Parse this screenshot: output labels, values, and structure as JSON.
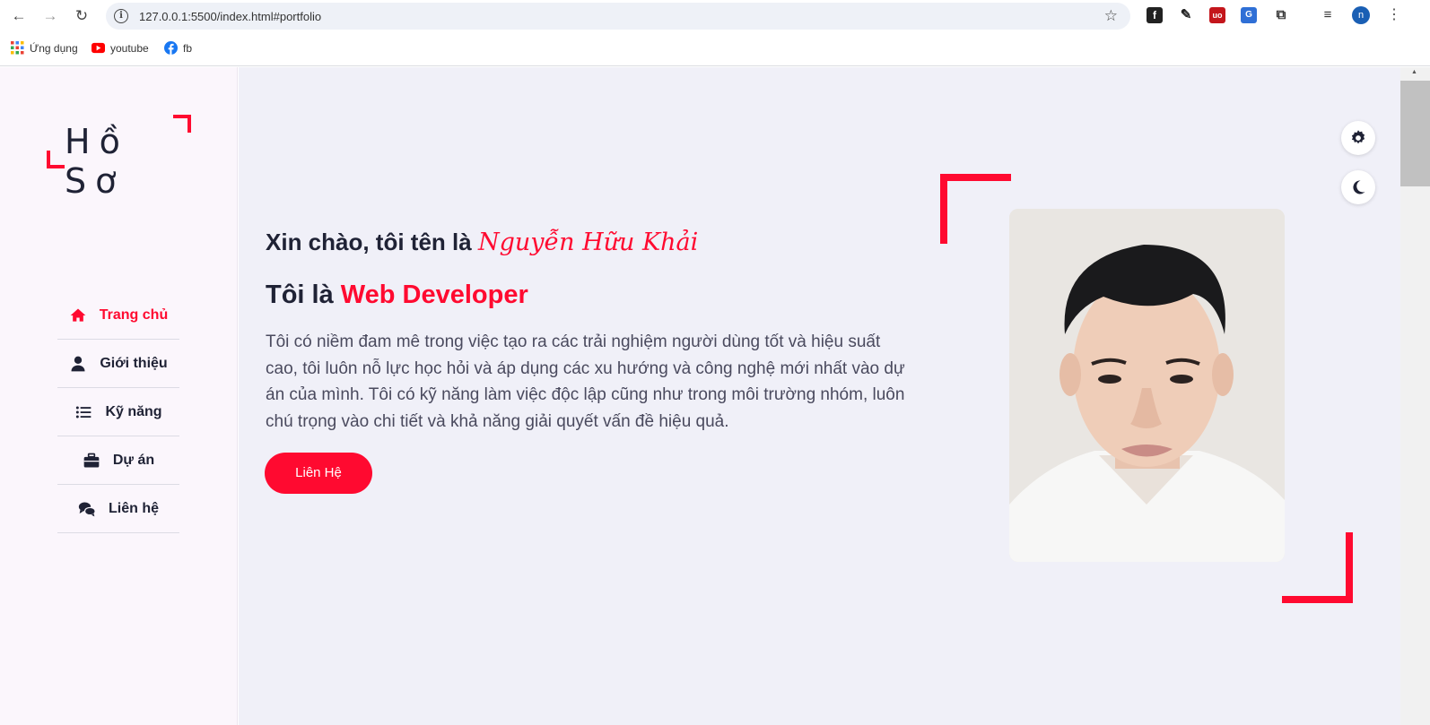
{
  "browser": {
    "url": "127.0.0.1:5500/index.html#portfolio",
    "profile_initial": "n",
    "bookmarks": [
      {
        "label": "Ứng dụng",
        "icon": "apps-grid-icon"
      },
      {
        "label": "youtube",
        "icon": "youtube-icon"
      },
      {
        "label": "fb",
        "icon": "facebook-icon"
      }
    ]
  },
  "logo": {
    "text": "Hồ Sơ"
  },
  "menu": [
    {
      "label": "Trang chủ",
      "icon": "home-icon",
      "active": true
    },
    {
      "label": "Giới thiệu",
      "icon": "user-icon",
      "active": false
    },
    {
      "label": "Kỹ năng",
      "icon": "list-icon",
      "active": false
    },
    {
      "label": "Dự án",
      "icon": "briefcase-icon",
      "active": false
    },
    {
      "label": "Liên hệ",
      "icon": "chat-icon",
      "active": false
    }
  ],
  "hero": {
    "greeting": "Xin chào, tôi tên là",
    "name": "Nguyễn Hữu Khải",
    "role_prefix": "Tôi là",
    "role": "Web Developer",
    "description": "Tôi có niềm đam mê trong việc tạo ra các trải nghiệm người dùng tốt và hiệu suất cao, tôi luôn nỗ lực học hỏi và áp dụng các xu hướng và công nghệ mới nhất vào dự án của mình. Tôi có kỹ năng làm việc độc lập cũng như trong môi trường nhóm, luôn chú trọng vào chi tiết và khả năng giải quyết vấn đề hiệu quả.",
    "cta_label": "Liên Hệ"
  },
  "colors": {
    "accent": "#ff0a30",
    "text": "#1f2235",
    "sidebar_bg": "#fbf6fc",
    "main_bg": "#f0f0f8"
  }
}
